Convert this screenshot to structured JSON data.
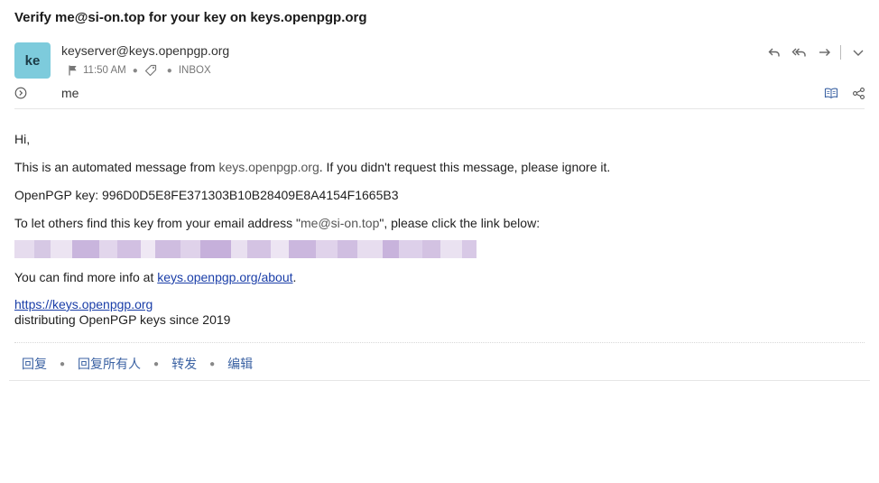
{
  "message": {
    "subject": "Verify me@si-on.top for your key on keys.openpgp.org",
    "avatar_initials": "ke",
    "avatar_color": "#7dcbdc",
    "sender": "keyserver@keys.openpgp.org",
    "time": "11:50 AM",
    "folder": "INBOX",
    "recipient": "me"
  },
  "icons": {
    "reply": "reply-icon",
    "reply_all": "reply-all-icon",
    "forward": "forward-icon",
    "more": "chevron-down-icon",
    "flag": "flag-icon",
    "tag": "tag-icon",
    "expand": "expand-circle-icon",
    "reader": "book-open-icon",
    "share": "share-icon"
  },
  "body": {
    "greeting": "Hi,",
    "line1_pre": "This is an automated message from ",
    "line1_link": "keys.openpgp.org",
    "line1_post": ". If you didn't request this message, please ignore it.",
    "key_line": "OpenPGP key: 996D0D5E8FE371303B10B28409E8A4154F1665B3",
    "line3_pre": "To let others find this key from your email address \"",
    "line3_email": "me@si-on.top",
    "line3_post": "\", please click the link below:",
    "more_pre": "You can find more info at ",
    "more_link": "keys.openpgp.org/about",
    "more_post": ".",
    "sig_link": "https://keys.openpgp.org",
    "sig_text": "distributing OpenPGP keys since 2019"
  },
  "reply_bar": {
    "reply": "回复",
    "reply_all": "回复所有人",
    "forward": "转发",
    "edit": "编辑"
  },
  "colors": {
    "link": "#1a3ea8",
    "action_link": "#3b62a3"
  }
}
